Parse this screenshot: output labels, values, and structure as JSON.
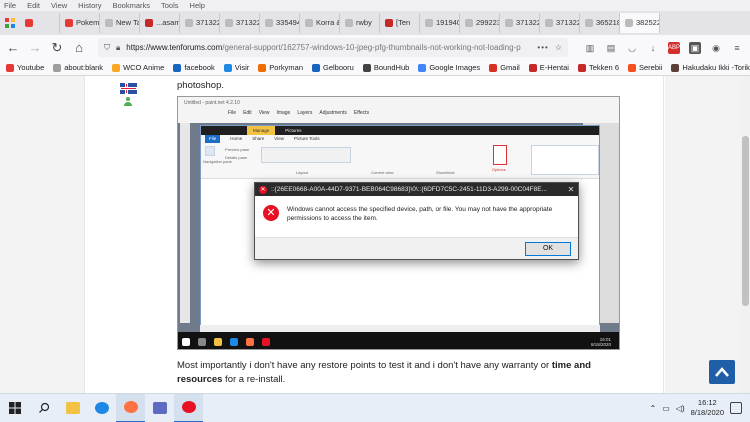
{
  "menubar": [
    "File",
    "Edit",
    "View",
    "History",
    "Bookmarks",
    "Tools",
    "Help"
  ],
  "tabs": [
    {
      "label": "",
      "color": "#e53935",
      "active": false
    },
    {
      "label": "Pokem",
      "color": "#e53935",
      "active": false
    },
    {
      "label": "New Tab",
      "color": "",
      "active": false
    },
    {
      "label": "...asam",
      "color": "#c62828",
      "active": false
    },
    {
      "label": "3713228",
      "color": "",
      "active": false
    },
    {
      "label": "3713227",
      "color": "",
      "active": false
    },
    {
      "label": "3354949",
      "color": "",
      "active": false
    },
    {
      "label": "Korra & Asa",
      "color": "",
      "active": false
    },
    {
      "label": "rwby",
      "color": "",
      "active": false
    },
    {
      "label": "[Ten",
      "color": "#c62828",
      "active": false
    },
    {
      "label": "1919408",
      "color": "",
      "active": false
    },
    {
      "label": "2992234",
      "color": "",
      "active": false
    },
    {
      "label": "3713228",
      "color": "",
      "active": false
    },
    {
      "label": "3713227",
      "color": "",
      "active": false
    },
    {
      "label": "3652181",
      "color": "",
      "active": false
    },
    {
      "label": "3825229",
      "color": "",
      "active": true
    }
  ],
  "url": {
    "host": "https://www.tenforums.com",
    "path": "/general-support/162757-windows-10-jpeg-pfg-thumbnails-not-working-not-loading-p",
    "dots": "•••"
  },
  "bookmarks": [
    {
      "label": "Youtube",
      "color": "#e53935"
    },
    {
      "label": "about:blank",
      "color": "#9e9e9e"
    },
    {
      "label": "WCO Anime",
      "color": "#f9a825"
    },
    {
      "label": "facebook",
      "color": "#1565c0"
    },
    {
      "label": "Visir",
      "color": "#1e88e5"
    },
    {
      "label": "Porkyman",
      "color": "#ef6c00"
    },
    {
      "label": "Gelbooru",
      "color": "#1565c0"
    },
    {
      "label": "BoundHub",
      "color": "#424242"
    },
    {
      "label": "Google Images",
      "color": "#4285f4"
    },
    {
      "label": "Gmail",
      "color": "#d93025"
    },
    {
      "label": "E-Hentai",
      "color": "#c62828"
    },
    {
      "label": "Tekken 6",
      "color": "#c62828"
    },
    {
      "label": "Serebii",
      "color": "#f4511e"
    },
    {
      "label": "Hakudaku Ikki -Toriko...",
      "color": "#5d4037"
    }
  ],
  "post": {
    "top_line": "photoshop.",
    "paragraph_plain": "Most importantly i don't have any restore points to test it and i don't have any warranty or ",
    "paragraph_bold1": "time and",
    "paragraph_bold2": "resources",
    "paragraph_end": " for a re-install."
  },
  "embedded": {
    "paint_title": "Untitled - paint.net 4.2.10",
    "paint_menu": [
      "File",
      "Edit",
      "View",
      "Image",
      "Layers",
      "Adjustments",
      "Effects"
    ],
    "explorer_title_manage": "Manage",
    "explorer_title_pictures": "Pictures",
    "explorer_tabs": [
      "File",
      "Home",
      "Share",
      "View",
      "Picture Tools"
    ],
    "ribbon_labels": [
      "Navigation pane",
      "Preview pane",
      "Details pane",
      "Layout",
      "Current view",
      "Show/hide",
      "Options"
    ],
    "clock_time": "16:01",
    "clock_date": "8/18/2020"
  },
  "dialog": {
    "title": "::{26EE0668-A00A-44D7-9371-BEB064C98683}\\0\\::{6DFD7C5C-2451-11D3-A299-00C04F8E...",
    "message": "Windows cannot access the specified device, path, or file. You may not have the appropriate permissions to access the item.",
    "ok_label": "OK",
    "close_glyph": "✕"
  },
  "taskbar": {
    "time": "16:12",
    "date": "8/18/2020"
  },
  "colors": {
    "accent": "#1f5fa8",
    "error": "#e81123"
  }
}
